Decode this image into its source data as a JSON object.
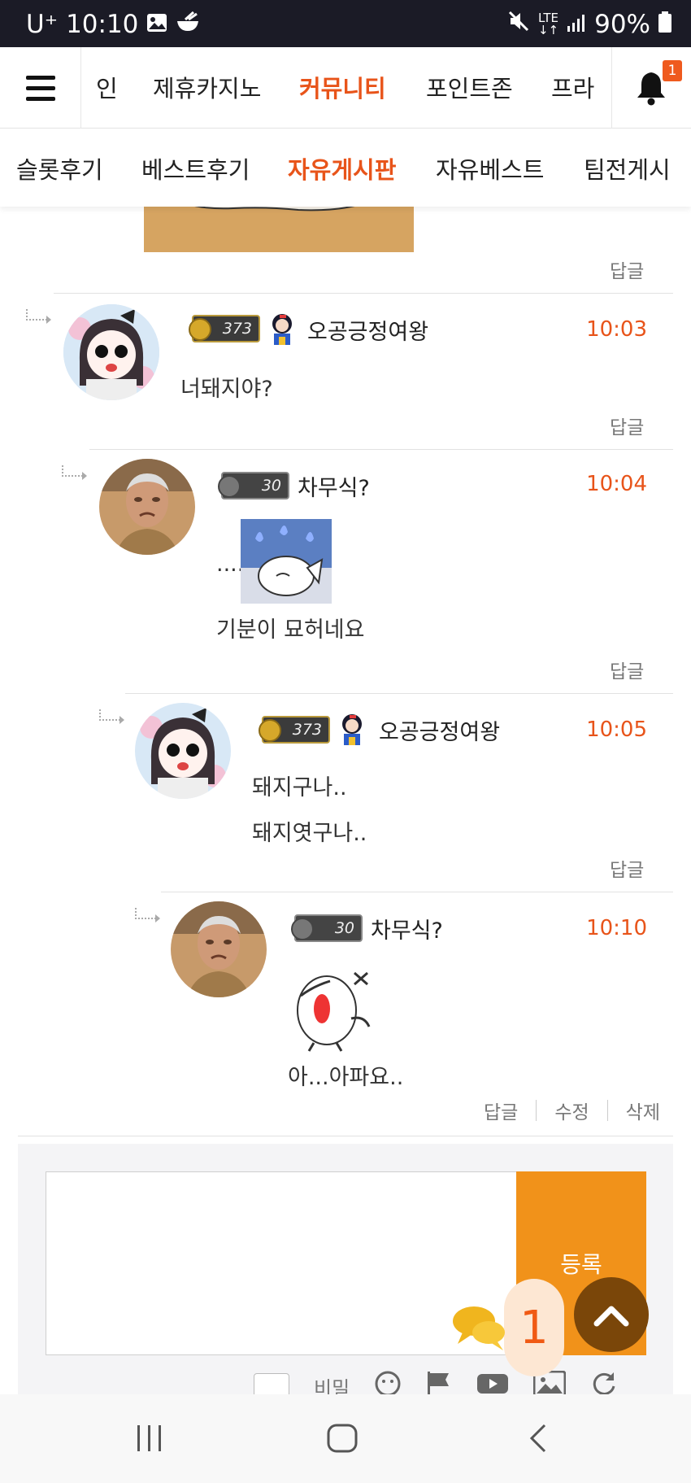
{
  "status_bar": {
    "carrier": "U⁺",
    "time": "10:10",
    "network": "LTE",
    "battery": "90%"
  },
  "nav": {
    "items": [
      "인",
      "제휴카지노",
      "커뮤니티",
      "포인트존",
      "프라"
    ],
    "active": "커뮤니티",
    "notification_count": "1"
  },
  "sub_nav": {
    "items": [
      "슬롯후기",
      "베스트후기",
      "자유게시판",
      "자유베스트",
      "팀전게시"
    ],
    "active": "자유게시판"
  },
  "reply_label": "답글",
  "comments": [
    {
      "level": "373",
      "nickname": "오공긍정여왕",
      "time": "10:03",
      "lines": [
        "너돼지야?"
      ]
    },
    {
      "level": "30",
      "nickname": "차무식?",
      "time": "10:04",
      "lines": [
        "....",
        "기분이 묘허네요"
      ]
    },
    {
      "level": "373",
      "nickname": "오공긍정여왕",
      "time": "10:05",
      "lines": [
        "돼지구나..",
        "돼지엿구나.."
      ]
    },
    {
      "level": "30",
      "nickname": "차무식?",
      "time": "10:10",
      "lines": [
        "아...아파요.."
      ]
    }
  ],
  "actions": {
    "reply": "답글",
    "edit": "수정",
    "delete": "삭제"
  },
  "form": {
    "submit_label": "등록",
    "secret_label": "비밀"
  },
  "floating": {
    "chat_count": "1"
  },
  "colors": {
    "accent": "#e8541a",
    "submit": "#f1921a",
    "scroll_top": "#7a4609"
  }
}
